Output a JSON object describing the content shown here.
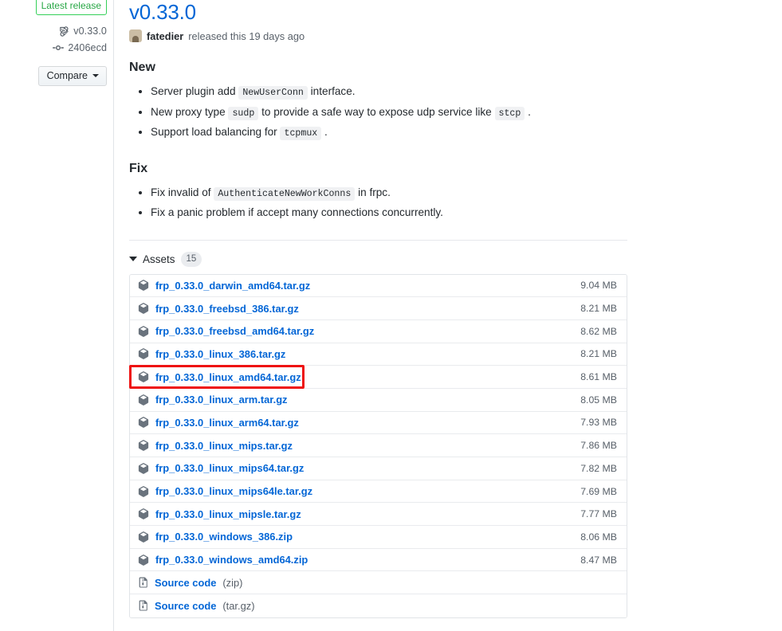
{
  "sidebar": {
    "latest_release_badge": "Latest release",
    "tag_icon": "tag-icon",
    "tag_name": "v0.33.0",
    "commit_icon": "commit-icon",
    "commit_sha": "2406ecd",
    "compare_label": "Compare"
  },
  "release": {
    "title": "v0.33.0",
    "author": "fatedier",
    "byline_rest": "released this 19 days ago",
    "avatar_name": "fatedier-avatar"
  },
  "sections": [
    {
      "heading": "New",
      "items": [
        {
          "parts": [
            {
              "t": "text",
              "v": "Server plugin add "
            },
            {
              "t": "code",
              "v": "NewUserConn"
            },
            {
              "t": "text",
              "v": " interface."
            }
          ]
        },
        {
          "parts": [
            {
              "t": "text",
              "v": "New proxy type "
            },
            {
              "t": "code",
              "v": "sudp"
            },
            {
              "t": "text",
              "v": " to provide a safe way to expose udp service like "
            },
            {
              "t": "code",
              "v": "stcp"
            },
            {
              "t": "text",
              "v": " ."
            }
          ]
        },
        {
          "parts": [
            {
              "t": "text",
              "v": "Support load balancing for "
            },
            {
              "t": "code",
              "v": "tcpmux"
            },
            {
              "t": "text",
              "v": " ."
            }
          ]
        }
      ]
    },
    {
      "heading": "Fix",
      "items": [
        {
          "parts": [
            {
              "t": "text",
              "v": "Fix invalid of "
            },
            {
              "t": "code",
              "v": "AuthenticateNewWorkConns"
            },
            {
              "t": "text",
              "v": " in frpc."
            }
          ]
        },
        {
          "parts": [
            {
              "t": "text",
              "v": "Fix a panic problem if accept many connections concurrently."
            }
          ]
        }
      ]
    }
  ],
  "assets": {
    "label": "Assets",
    "count": "15",
    "rows": [
      {
        "icon": "package-icon",
        "name": "frp_0.33.0_darwin_amd64.tar.gz",
        "suffix": "",
        "size": "9.04 MB",
        "highlighted": false
      },
      {
        "icon": "package-icon",
        "name": "frp_0.33.0_freebsd_386.tar.gz",
        "suffix": "",
        "size": "8.21 MB",
        "highlighted": false
      },
      {
        "icon": "package-icon",
        "name": "frp_0.33.0_freebsd_amd64.tar.gz",
        "suffix": "",
        "size": "8.62 MB",
        "highlighted": false
      },
      {
        "icon": "package-icon",
        "name": "frp_0.33.0_linux_386.tar.gz",
        "suffix": "",
        "size": "8.21 MB",
        "highlighted": false
      },
      {
        "icon": "package-icon",
        "name": "frp_0.33.0_linux_amd64.tar.gz",
        "suffix": "",
        "size": "8.61 MB",
        "highlighted": true
      },
      {
        "icon": "package-icon",
        "name": "frp_0.33.0_linux_arm.tar.gz",
        "suffix": "",
        "size": "8.05 MB",
        "highlighted": false
      },
      {
        "icon": "package-icon",
        "name": "frp_0.33.0_linux_arm64.tar.gz",
        "suffix": "",
        "size": "7.93 MB",
        "highlighted": false
      },
      {
        "icon": "package-icon",
        "name": "frp_0.33.0_linux_mips.tar.gz",
        "suffix": "",
        "size": "7.86 MB",
        "highlighted": false
      },
      {
        "icon": "package-icon",
        "name": "frp_0.33.0_linux_mips64.tar.gz",
        "suffix": "",
        "size": "7.82 MB",
        "highlighted": false
      },
      {
        "icon": "package-icon",
        "name": "frp_0.33.0_linux_mips64le.tar.gz",
        "suffix": "",
        "size": "7.69 MB",
        "highlighted": false
      },
      {
        "icon": "package-icon",
        "name": "frp_0.33.0_linux_mipsle.tar.gz",
        "suffix": "",
        "size": "7.77 MB",
        "highlighted": false
      },
      {
        "icon": "package-icon",
        "name": "frp_0.33.0_windows_386.zip",
        "suffix": "",
        "size": "8.06 MB",
        "highlighted": false
      },
      {
        "icon": "package-icon",
        "name": "frp_0.33.0_windows_amd64.zip",
        "suffix": "",
        "size": "8.47 MB",
        "highlighted": false
      },
      {
        "icon": "file-zip-icon",
        "name": "Source code",
        "suffix": " (zip)",
        "size": "",
        "highlighted": false
      },
      {
        "icon": "file-zip-icon",
        "name": "Source code",
        "suffix": " (tar.gz)",
        "size": "",
        "highlighted": false
      }
    ]
  },
  "colors": {
    "link": "#0366d6",
    "muted": "#586069",
    "badge_green": "#28a745",
    "border": "#e1e4e8",
    "highlight_red": "#ee1111"
  }
}
